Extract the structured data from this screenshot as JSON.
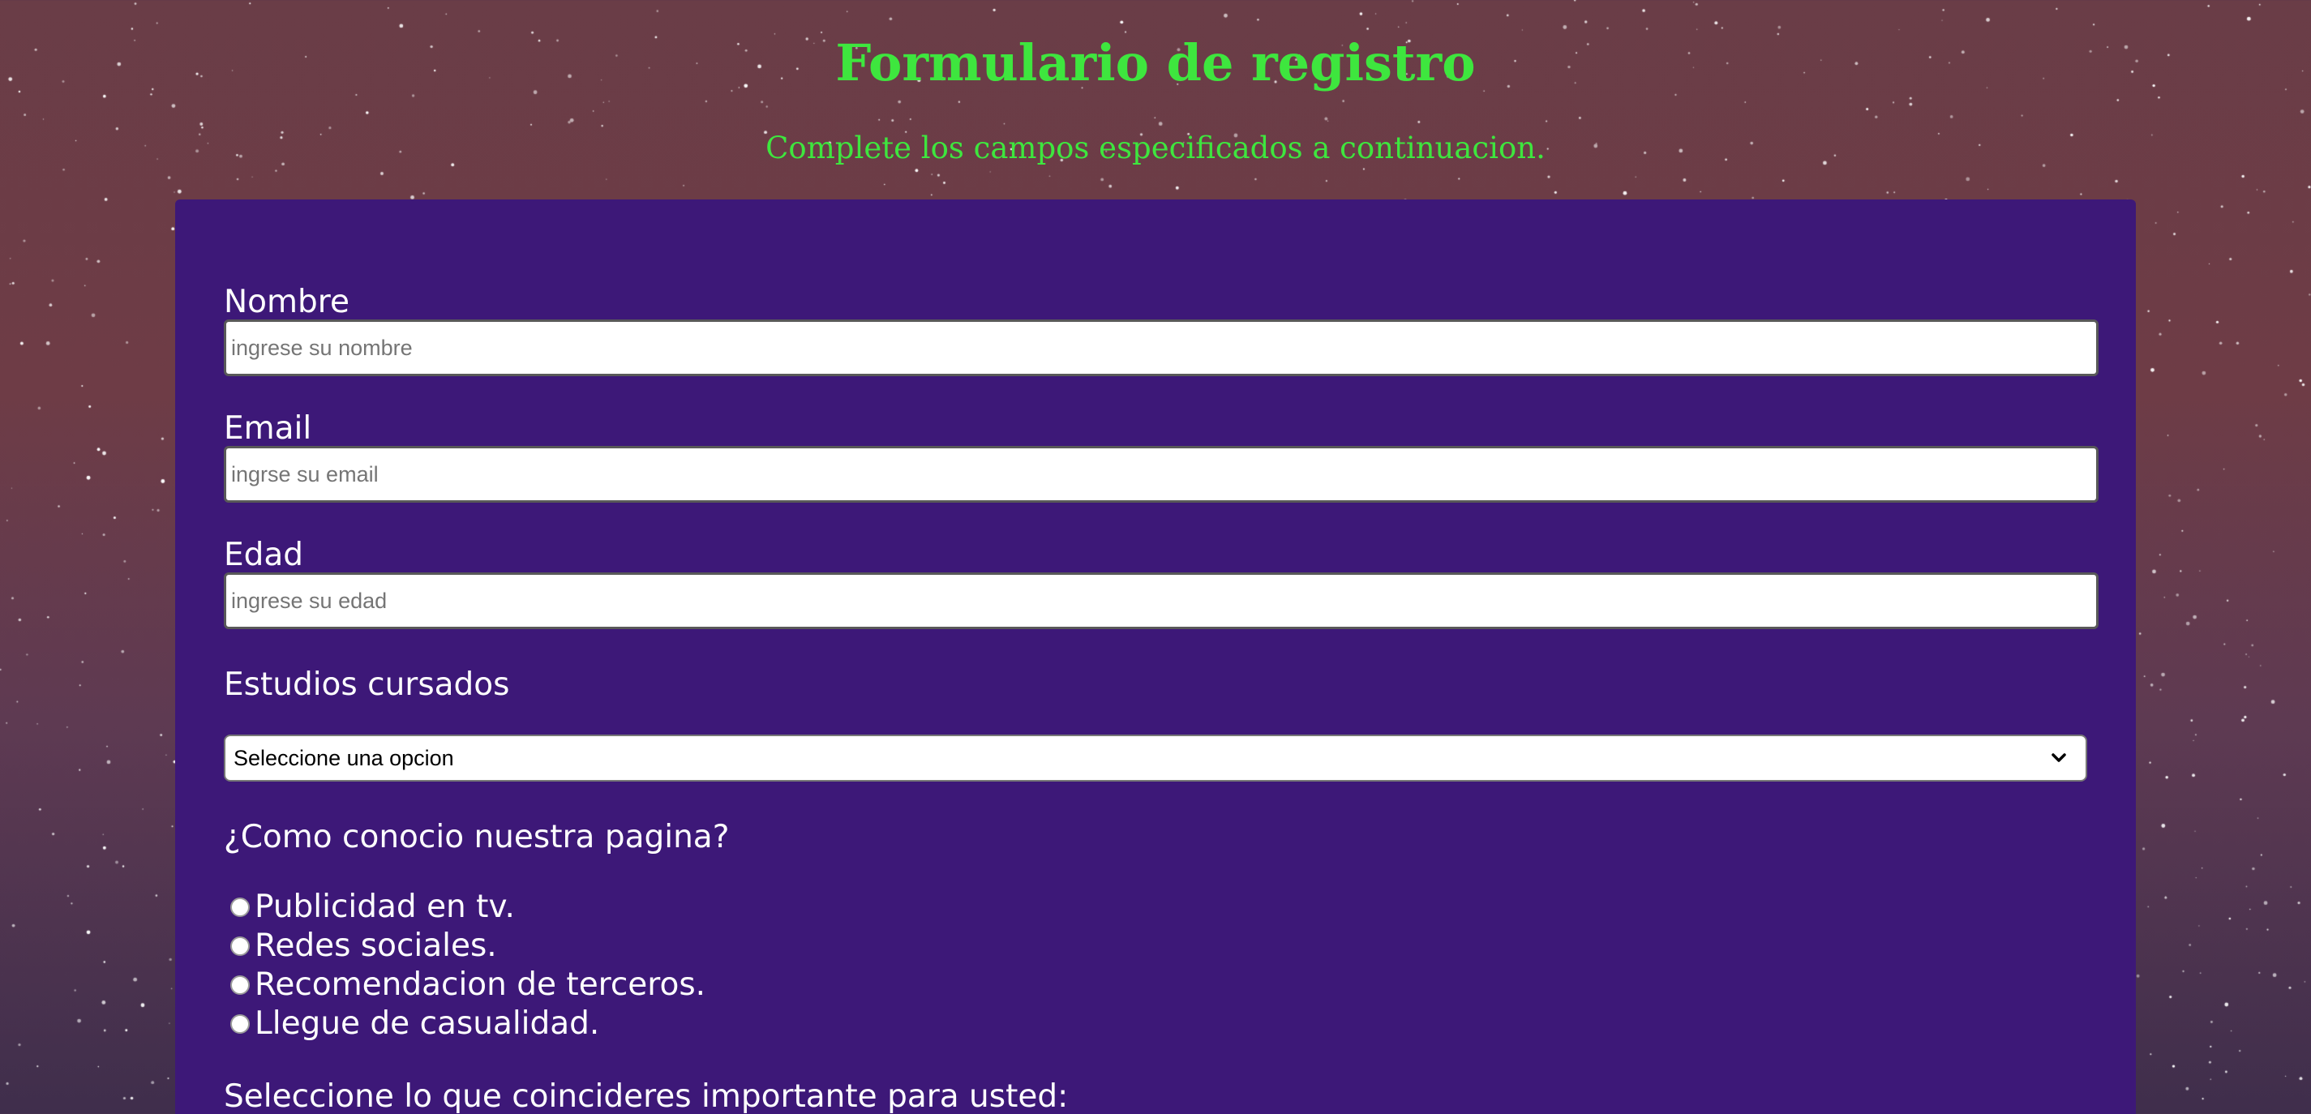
{
  "header": {
    "title": "Formulario de registro",
    "subtitle": "Complete los campos especificados a continuacion."
  },
  "form": {
    "fields": [
      {
        "label": "Nombre",
        "placeholder": "ingrese su nombre",
        "value": ""
      },
      {
        "label": "Email",
        "placeholder": "ingrse su email",
        "value": ""
      },
      {
        "label": "Edad",
        "placeholder": "ingrese su edad",
        "value": ""
      }
    ],
    "studies": {
      "label": "Estudios cursados",
      "selected": "Seleccione una opcion"
    },
    "discovery": {
      "question": "¿Como conocio nuestra pagina?",
      "options": [
        "Publicidad en tv.",
        "Redes sociales.",
        "Recomendacion de terceros.",
        "Llegue de casualidad."
      ]
    },
    "importance_label": "Seleccione lo que coincideres importante para usted:"
  },
  "colors": {
    "heading_green": "#3ee63e",
    "panel_purple": "#3d1878",
    "background": "#6a3d47"
  }
}
